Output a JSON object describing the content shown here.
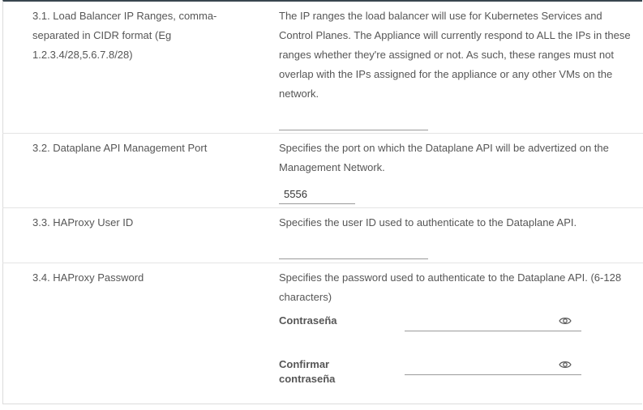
{
  "rows": [
    {
      "label": "3.1. Load Balancer IP Ranges, comma-separated in CIDR format (Eg 1.2.3.4/28,5.6.7.8/28)",
      "description": "The IP ranges the load balancer will use for Kubernetes Services and Control Planes. The Appliance will currently respond to ALL the IPs in these ranges whether they're assigned or not. As such, these ranges must not overlap with the IPs assigned for the appliance or any other VMs on the network.",
      "value": ""
    },
    {
      "label": "3.2. Dataplane API Management Port",
      "description": "Specifies the port on which the Dataplane API will be advertized on the Management Network.",
      "value": "5556"
    },
    {
      "label": "3.3. HAProxy User ID",
      "description": "Specifies the user ID used to authenticate to the Dataplane API.",
      "value": ""
    },
    {
      "label": "3.4. HAProxy Password",
      "description": "Specifies the password used to authenticate to the Dataplane API. (6-128 characters)",
      "password_label": "Contraseña",
      "confirm_label": "Confirmar contraseña",
      "password_value": "",
      "confirm_value": ""
    }
  ],
  "icons": {
    "show_password": "eye-icon"
  }
}
